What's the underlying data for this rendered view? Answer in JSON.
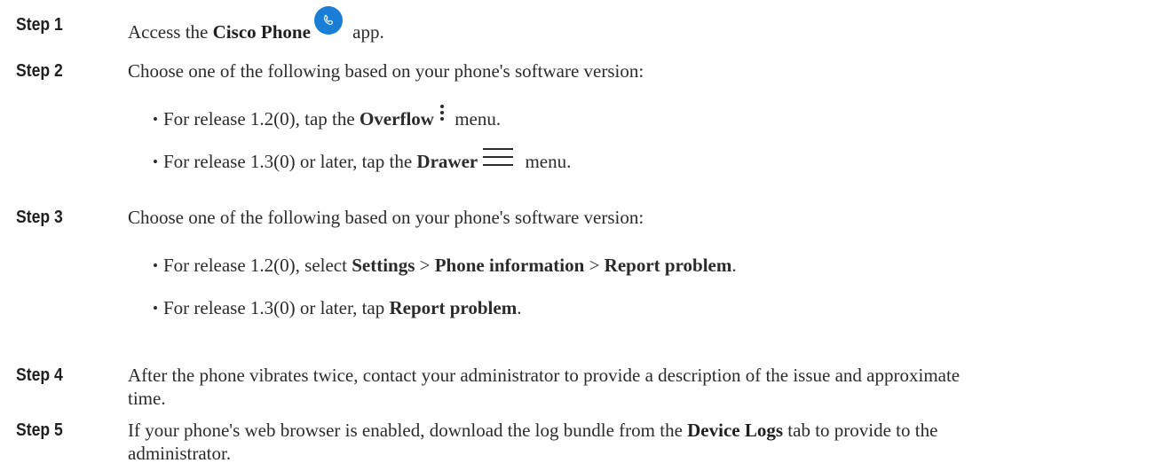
{
  "steps": [
    {
      "label": "Step 1",
      "pre": "Access the ",
      "app_name": "Cisco Phone",
      "post": " app."
    },
    {
      "label": "Step 2",
      "text": "Choose one of the following based on your phone's software version:",
      "bullets": [
        {
          "pre": "For release 1.2(0), tap the ",
          "bold": "Overflow",
          "post": " menu.",
          "icon": "overflow-menu-icon"
        },
        {
          "pre": "For release 1.3(0) or later, tap the ",
          "bold": "Drawer",
          "post": " menu.",
          "icon": "drawer-menu-icon"
        }
      ]
    },
    {
      "label": "Step 3",
      "text": "Choose one of the following based on your phone's software version:",
      "bullets": [
        {
          "pre": "For release 1.2(0), select ",
          "b1": "Settings",
          "sep1": " > ",
          "b2": "Phone information",
          "sep2": " > ",
          "b3": "Report problem",
          "post": "."
        },
        {
          "pre": "For release 1.3(0) or later, tap ",
          "bold": "Report problem",
          "post": "."
        }
      ]
    },
    {
      "label": "Step 4",
      "line1": "After the phone vibrates twice, contact your administrator to provide a description of the issue and approximate",
      "line2": "time."
    },
    {
      "label": "Step 5",
      "line1_pre": "If your phone's web browser is enabled, download the log bundle from the ",
      "line1_bold": "Device Logs",
      "line1_post": " tab to provide to the",
      "line2": "administrator."
    }
  ],
  "bullet_char": "•",
  "colors": {
    "phone_icon_bg": "#1b7ed6",
    "text": "#2b2b2b"
  }
}
